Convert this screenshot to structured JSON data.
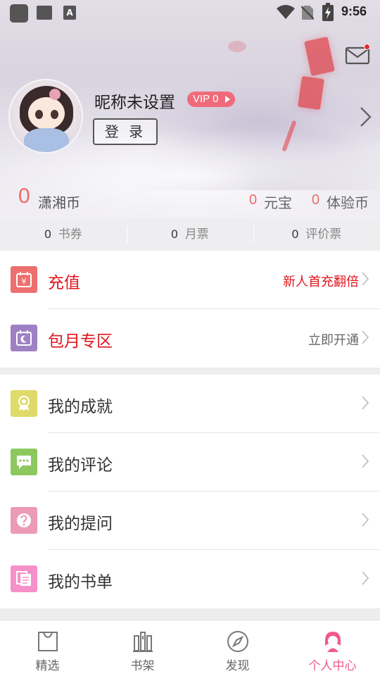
{
  "status_bar": {
    "time": "9:56",
    "notification_app_letter": "A"
  },
  "profile": {
    "nickname": "昵称未设置",
    "vip_label": "VIP 0",
    "login_label": "登 录"
  },
  "balances": {
    "xiaoxiang_coin": {
      "value": "0",
      "label": "潇湘币"
    },
    "yuanbao": {
      "value": "0",
      "label": "元宝"
    },
    "trial_coin": {
      "value": "0",
      "label": "体验币"
    }
  },
  "tickets": [
    {
      "value": "0",
      "label": "书券"
    },
    {
      "value": "0",
      "label": "月票"
    },
    {
      "value": "0",
      "label": "评价票"
    }
  ],
  "menu_primary": [
    {
      "label": "充值",
      "side": "新人首充翻倍",
      "icon": "yuan-calendar-icon",
      "color": "#ee6f6f"
    },
    {
      "label": "包月专区",
      "side": "立即开通",
      "icon": "moon-calendar-icon",
      "color": "#9d81c4"
    }
  ],
  "menu_secondary": [
    {
      "label": "我的成就",
      "icon": "medal-icon",
      "color": "#dedb6a"
    },
    {
      "label": "我的评论",
      "icon": "comment-icon",
      "color": "#8dc85f"
    },
    {
      "label": "我的提问",
      "icon": "question-icon",
      "color": "#ec9ab8"
    },
    {
      "label": "我的书单",
      "icon": "booklist-icon",
      "color": "#f690c8"
    }
  ],
  "bottom_nav": [
    {
      "label": "精选",
      "icon": "shopping-bag-icon",
      "active": false
    },
    {
      "label": "书架",
      "icon": "bookshelf-icon",
      "active": false
    },
    {
      "label": "发现",
      "icon": "compass-icon",
      "active": false
    },
    {
      "label": "个人中心",
      "icon": "girl-avatar-icon",
      "active": true
    }
  ],
  "colors": {
    "accent_pink": "#ef5a88",
    "alert_red": "#e0161e",
    "coin_red": "#ec6b6b"
  }
}
